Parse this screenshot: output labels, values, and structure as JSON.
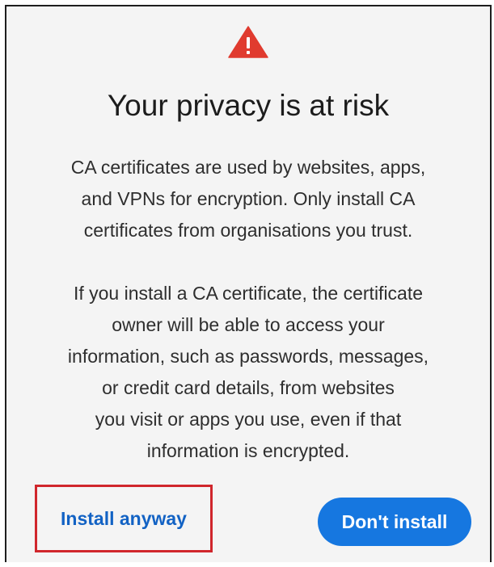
{
  "dialog": {
    "icon": "warning-triangle-icon",
    "title": "Your privacy is at risk",
    "paragraph1": [
      "CA certificates are used by websites, apps,",
      "and VPNs for encryption. Only install CA",
      "certificates from organisations you trust."
    ],
    "paragraph2": [
      "If you install a CA certificate, the certificate",
      "owner will be able to access your",
      "information, such as passwords, messages,",
      "or credit card details, from websites",
      "you visit or apps you use, even if that",
      "information is encrypted."
    ],
    "install_anyway_label": "Install anyway",
    "dont_install_label": "Don't install"
  },
  "colors": {
    "warning": "#e03b2f",
    "primary": "#1677e0",
    "link": "#1262c4",
    "highlight_border": "#d0262c",
    "background": "#f4f4f4"
  }
}
